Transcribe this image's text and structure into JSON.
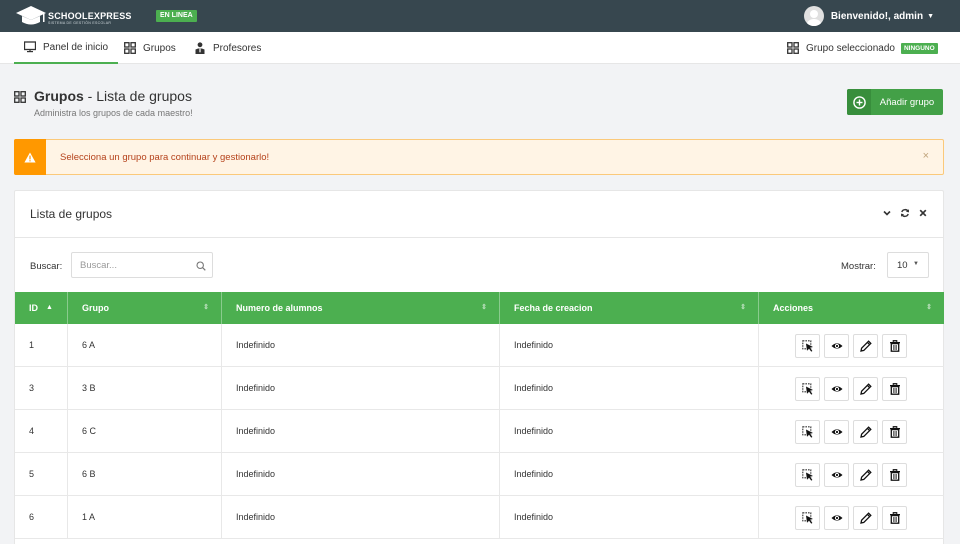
{
  "topbar": {
    "logo_text": "SCHOOLEXPRESS",
    "logo_sub": "SISTEMA DE GESTIÓN ESCOLAR",
    "status_badge": "EN LINEA",
    "user_greeting": "Bienvenido!, admin"
  },
  "nav": {
    "items": [
      {
        "label": "Panel de inicio",
        "icon": "monitor-icon"
      },
      {
        "label": "Grupos",
        "icon": "grid-icon"
      },
      {
        "label": "Profesores",
        "icon": "teacher-icon"
      }
    ],
    "selected_group_label": "Grupo seleccionado",
    "selected_group_value": "NINGUNO"
  },
  "page": {
    "title_bold": "Grupos",
    "title_rest": " - Lista de grupos",
    "subtitle": "Administra los grupos de cada maestro!",
    "add_button": "Añadir grupo"
  },
  "alert": {
    "text": "Selecciona un grupo para continuar y gestionarlo!",
    "close": "×"
  },
  "panel": {
    "title": "Lista de grupos",
    "search_label": "Buscar:",
    "search_placeholder": "Buscar...",
    "show_label": "Mostrar:",
    "show_value": "10"
  },
  "table": {
    "headers": [
      "ID",
      "Grupo",
      "Numero de alumnos",
      "Fecha de creacion",
      "Acciones"
    ],
    "rows": [
      {
        "id": "1",
        "grupo": "6 A",
        "alumnos": "Indefinido",
        "fecha": "Indefinido"
      },
      {
        "id": "3",
        "grupo": "3 B",
        "alumnos": "Indefinido",
        "fecha": "Indefinido"
      },
      {
        "id": "4",
        "grupo": "6 C",
        "alumnos": "Indefinido",
        "fecha": "Indefinido"
      },
      {
        "id": "5",
        "grupo": "6 B",
        "alumnos": "Indefinido",
        "fecha": "Indefinido"
      },
      {
        "id": "6",
        "grupo": "1 A",
        "alumnos": "Indefinido",
        "fecha": "Indefinido"
      }
    ],
    "action_icons": [
      "select-pointer-icon",
      "eye-icon",
      "pencil-icon",
      "trash-icon"
    ]
  },
  "colors": {
    "topbar": "#37474f",
    "accent_green": "#4caf50",
    "alert_orange": "#ff9800",
    "alert_text": "#b5421b"
  }
}
